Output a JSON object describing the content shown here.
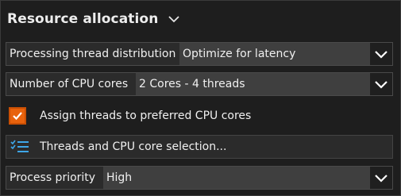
{
  "section": {
    "title": "Resource allocation"
  },
  "thread_distribution": {
    "label": "Processing thread distribution",
    "value": "Optimize for latency"
  },
  "cpu_cores": {
    "label": "Number of CPU cores",
    "value": "2 Cores - 4 threads"
  },
  "assign_threads": {
    "label": "Assign threads to preferred CPU cores",
    "checked": true
  },
  "core_selection": {
    "label": "Threads and CPU core selection..."
  },
  "process_priority": {
    "label": "Process priority",
    "value": "High"
  },
  "colors": {
    "accent": "#e8620c",
    "icon_accent": "#3ea6e8",
    "panel_bg": "#1e1e1e",
    "field_bg": "#3f3f3f",
    "text": "#f0f0f0"
  }
}
